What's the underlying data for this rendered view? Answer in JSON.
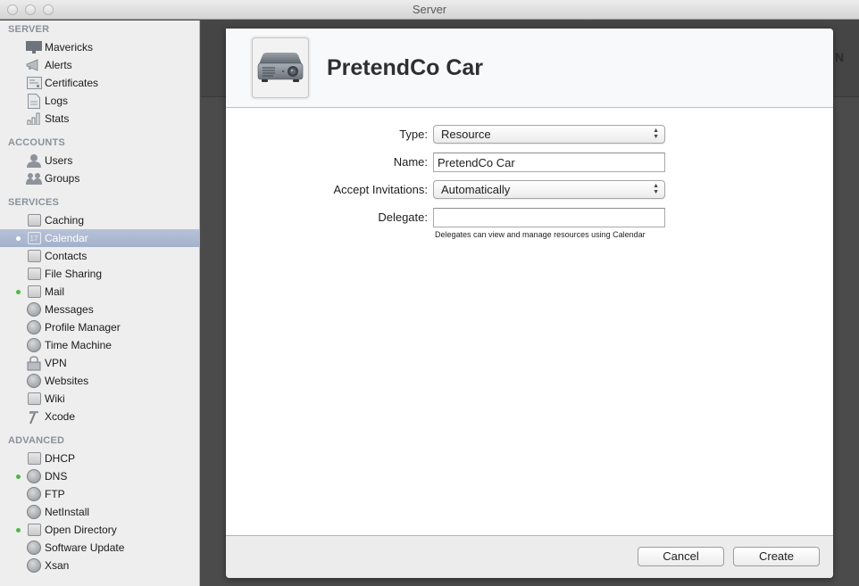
{
  "window": {
    "title": "Server"
  },
  "sidebar": {
    "sections": [
      {
        "title": "SERVER",
        "items": [
          {
            "label": "Mavericks",
            "icon": "monitor-icon",
            "status": ""
          },
          {
            "label": "Alerts",
            "icon": "megaphone-icon",
            "status": ""
          },
          {
            "label": "Certificates",
            "icon": "certificate-icon",
            "status": ""
          },
          {
            "label": "Logs",
            "icon": "document-icon",
            "status": ""
          },
          {
            "label": "Stats",
            "icon": "bar-chart-icon",
            "status": ""
          }
        ]
      },
      {
        "title": "ACCOUNTS",
        "items": [
          {
            "label": "Users",
            "icon": "user-icon",
            "status": ""
          },
          {
            "label": "Groups",
            "icon": "group-icon",
            "status": ""
          }
        ]
      },
      {
        "title": "SERVICES",
        "items": [
          {
            "label": "Caching",
            "icon": "caching-icon",
            "status": ""
          },
          {
            "label": "Calendar",
            "icon": "calendar-icon",
            "status": "on",
            "selected": true,
            "icon_text": "17"
          },
          {
            "label": "Contacts",
            "icon": "contacts-icon",
            "status": ""
          },
          {
            "label": "File Sharing",
            "icon": "folder-icon",
            "status": ""
          },
          {
            "label": "Mail",
            "icon": "mail-icon",
            "status": "on"
          },
          {
            "label": "Messages",
            "icon": "messages-icon",
            "status": ""
          },
          {
            "label": "Profile Manager",
            "icon": "profile-manager-icon",
            "status": ""
          },
          {
            "label": "Time Machine",
            "icon": "time-machine-icon",
            "status": ""
          },
          {
            "label": "VPN",
            "icon": "lock-icon",
            "status": ""
          },
          {
            "label": "Websites",
            "icon": "globe-icon",
            "status": ""
          },
          {
            "label": "Wiki",
            "icon": "wiki-icon",
            "status": ""
          },
          {
            "label": "Xcode",
            "icon": "hammer-icon",
            "status": ""
          }
        ]
      },
      {
        "title": "ADVANCED",
        "items": [
          {
            "label": "DHCP",
            "icon": "dhcp-icon",
            "status": ""
          },
          {
            "label": "DNS",
            "icon": "dns-icon",
            "status": "on"
          },
          {
            "label": "FTP",
            "icon": "ftp-icon",
            "status": ""
          },
          {
            "label": "NetInstall",
            "icon": "netinstall-icon",
            "status": ""
          },
          {
            "label": "Open Directory",
            "icon": "open-directory-icon",
            "status": "on"
          },
          {
            "label": "Software Update",
            "icon": "software-update-icon",
            "status": ""
          },
          {
            "label": "Xsan",
            "icon": "xsan-icon",
            "status": ""
          }
        ]
      }
    ]
  },
  "background": {
    "partial_letter": "N"
  },
  "dialog": {
    "icon": "projector-icon",
    "title": "PretendCo Car",
    "fields": {
      "type": {
        "label": "Type:",
        "value": "Resource"
      },
      "name": {
        "label": "Name:",
        "value": "PretendCo Car",
        "placeholder": ""
      },
      "accept_invitations": {
        "label": "Accept Invitations:",
        "value": "Automatically"
      },
      "delegate": {
        "label": "Delegate:",
        "value": "",
        "placeholder": "",
        "hint": "Delegates can view and manage resources using Calendar"
      }
    },
    "buttons": {
      "cancel": "Cancel",
      "create": "Create"
    }
  }
}
